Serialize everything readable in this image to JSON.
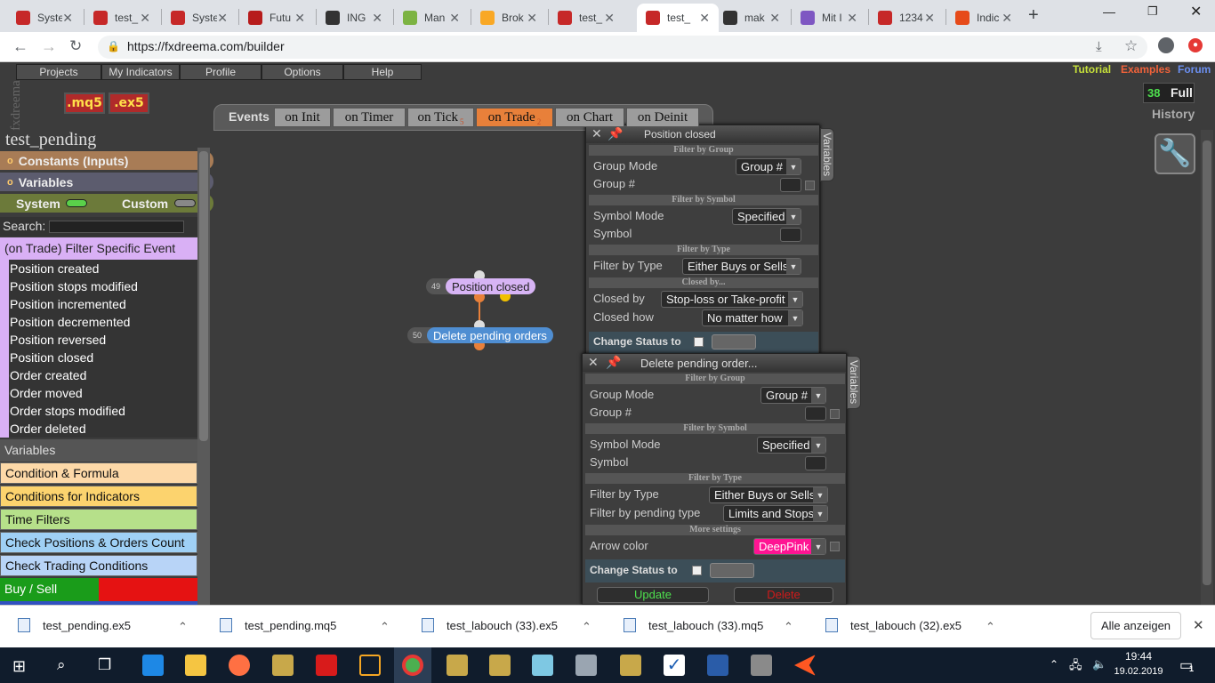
{
  "browser": {
    "tabs": [
      {
        "title": "Syste",
        "favicon_color": "#c62828"
      },
      {
        "title": "test_",
        "favicon_color": "#c62828"
      },
      {
        "title": "Syste",
        "favicon_color": "#c62828"
      },
      {
        "title": "Futu",
        "favicon_color": "#b71c1c"
      },
      {
        "title": "ING",
        "favicon_color": "#333333"
      },
      {
        "title": "Man",
        "favicon_color": "#7cb342"
      },
      {
        "title": "Brok",
        "favicon_color": "#f9a825"
      },
      {
        "title": "test_",
        "favicon_color": "#c62828"
      },
      {
        "title": "test_",
        "favicon_color": "#c62828"
      },
      {
        "title": "mak",
        "favicon_color": "#333333"
      },
      {
        "title": "Mit I",
        "favicon_color": "#7e57c2"
      },
      {
        "title": "1234",
        "favicon_color": "#c62828"
      },
      {
        "title": "Indic",
        "favicon_color": "#e64a19"
      }
    ],
    "url": "https://fxdreema.com/builder"
  },
  "app": {
    "logo": "fxdreema",
    "menu": [
      "Projects",
      "My Indicators",
      "Profile",
      "Options",
      "Help"
    ],
    "file_buttons": [
      ".mq5",
      ".ex5"
    ],
    "links": {
      "tutorial": "Tutorial",
      "examples": "Examples",
      "forum": "Forum"
    },
    "count": "38",
    "full": "Full",
    "history": "History",
    "events_label": "Events",
    "event_tabs": [
      {
        "label": "on Init",
        "sub": ""
      },
      {
        "label": "on Timer",
        "sub": ""
      },
      {
        "label": "on Tick",
        "sub": "5"
      },
      {
        "label": "on Trade",
        "sub": "2"
      },
      {
        "label": "on Chart",
        "sub": ""
      },
      {
        "label": "on Deinit",
        "sub": ""
      }
    ]
  },
  "sidebar": {
    "project_name": "test_pending",
    "constants": "Constants (Inputs)",
    "constants_bullet": "o",
    "variables_header": "Variables",
    "variables_bullet": "o",
    "system": "System",
    "custom": "Custom",
    "search_label": "Search:",
    "filter_header": "(on Trade) Filter Specific Event",
    "events": [
      "Position created",
      "Position stops modified",
      "Position incremented",
      "Position decremented",
      "Position reversed",
      "Position closed",
      "Order created",
      "Order moved",
      "Order stops modified",
      "Order deleted"
    ],
    "variables_section": "Variables",
    "categories": [
      {
        "label": "Condition & Formula",
        "color": "#fdd9a8"
      },
      {
        "label": "Conditions for Indicators",
        "color": "#fcd36e"
      },
      {
        "label": "Time Filters",
        "color": "#b6e08a"
      },
      {
        "label": "Check Positions & Orders Count",
        "color": "#9fd0f5"
      },
      {
        "label": "Check Trading Conditions",
        "color": "#b8d4f7"
      }
    ],
    "buy_sell": "Buy / Sell"
  },
  "nodes": [
    {
      "num": "49",
      "label": "Position closed",
      "color": "#d7b4f5"
    },
    {
      "num": "50",
      "label": "Delete pending orders",
      "color": "#4f8ed2"
    }
  ],
  "panel1": {
    "title": "Position closed",
    "variables_tab": "Variables",
    "filter_group": "Filter by Group",
    "group_mode_label": "Group Mode",
    "group_mode_value": "Group #",
    "group_num_label": "Group #",
    "filter_symbol": "Filter by Symbol",
    "symbol_mode_label": "Symbol Mode",
    "symbol_mode_value": "Specified",
    "symbol_label": "Symbol",
    "filter_type": "Filter by Type",
    "filter_type_label": "Filter by Type",
    "filter_type_value": "Either Buys or Sells",
    "closed_by_section": "Closed by...",
    "closed_by_label": "Closed by",
    "closed_by_value": "Stop-loss or Take-profit",
    "closed_how_label": "Closed how",
    "closed_how_value": "No matter how",
    "change_status": "Change Status to"
  },
  "panel2": {
    "title": "Delete pending order...",
    "variables_tab": "Variables",
    "filter_group": "Filter by Group",
    "group_mode_label": "Group Mode",
    "group_mode_value": "Group #",
    "group_num_label": "Group #",
    "filter_symbol": "Filter by Symbol",
    "symbol_mode_label": "Symbol Mode",
    "symbol_mode_value": "Specified",
    "symbol_label": "Symbol",
    "filter_type": "Filter by Type",
    "filter_type_label": "Filter by Type",
    "filter_type_value": "Either Buys or Sells",
    "pending_type_label": "Filter by pending type",
    "pending_type_value": "Limits and Stops",
    "more_settings": "More settings",
    "arrow_color_label": "Arrow color",
    "arrow_color_value": "DeepPink",
    "change_status": "Change Status to",
    "update": "Update",
    "delete": "Delete"
  },
  "downloads": {
    "items": [
      "test_pending.ex5",
      "test_pending.mq5",
      "test_labouch (33).ex5",
      "test_labouch (33).mq5",
      "test_labouch (32).ex5"
    ],
    "show_all": "Alle anzeigen"
  },
  "taskbar": {
    "time": "19:44",
    "date": "19.02.2019",
    "notifications": "1"
  }
}
